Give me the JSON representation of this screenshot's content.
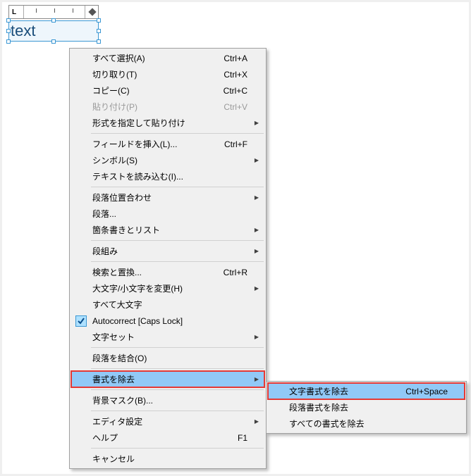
{
  "text_box": {
    "content": "text"
  },
  "main_menu": {
    "items": [
      {
        "label": "すべて選択(A)",
        "shortcut": "Ctrl+A",
        "type": "item"
      },
      {
        "label": "切り取り(T)",
        "shortcut": "Ctrl+X",
        "type": "item"
      },
      {
        "label": "コピー(C)",
        "shortcut": "Ctrl+C",
        "type": "item"
      },
      {
        "label": "貼り付け(P)",
        "shortcut": "Ctrl+V",
        "type": "item",
        "disabled": true
      },
      {
        "label": "形式を指定して貼り付け",
        "submenu": true,
        "type": "item"
      },
      {
        "type": "sep"
      },
      {
        "label": "フィールドを挿入(L)...",
        "shortcut": "Ctrl+F",
        "type": "item"
      },
      {
        "label": "シンボル(S)",
        "submenu": true,
        "type": "item"
      },
      {
        "label": "テキストを読み込む(I)...",
        "type": "item"
      },
      {
        "type": "sep"
      },
      {
        "label": "段落位置合わせ",
        "submenu": true,
        "type": "item"
      },
      {
        "label": "段落...",
        "type": "item"
      },
      {
        "label": "箇条書きとリスト",
        "submenu": true,
        "type": "item"
      },
      {
        "type": "sep"
      },
      {
        "label": "段組み",
        "submenu": true,
        "type": "item"
      },
      {
        "type": "sep"
      },
      {
        "label": "検索と置換...",
        "shortcut": "Ctrl+R",
        "type": "item"
      },
      {
        "label": "大文字/小文字を変更(H)",
        "submenu": true,
        "type": "item"
      },
      {
        "label": "すべて大文字",
        "type": "item"
      },
      {
        "label": "Autocorrect [Caps Lock]",
        "type": "item",
        "checked": true
      },
      {
        "label": "文字セット",
        "submenu": true,
        "type": "item"
      },
      {
        "type": "sep"
      },
      {
        "label": "段落を結合(O)",
        "type": "item"
      },
      {
        "type": "sep"
      },
      {
        "label": "書式を除去",
        "submenu": true,
        "type": "item",
        "highlight": "red"
      },
      {
        "type": "sep"
      },
      {
        "label": "背景マスク(B)...",
        "type": "item"
      },
      {
        "type": "sep"
      },
      {
        "label": "エディタ設定",
        "submenu": true,
        "type": "item"
      },
      {
        "label": "ヘルプ",
        "shortcut": "F1",
        "type": "item"
      },
      {
        "type": "sep"
      },
      {
        "label": "キャンセル",
        "type": "item"
      }
    ]
  },
  "sub_menu": {
    "items": [
      {
        "label": "文字書式を除去",
        "shortcut": "Ctrl+Space",
        "type": "item",
        "highlight": "red"
      },
      {
        "label": "段落書式を除去",
        "type": "item"
      },
      {
        "label": "すべての書式を除去",
        "type": "item"
      }
    ]
  }
}
